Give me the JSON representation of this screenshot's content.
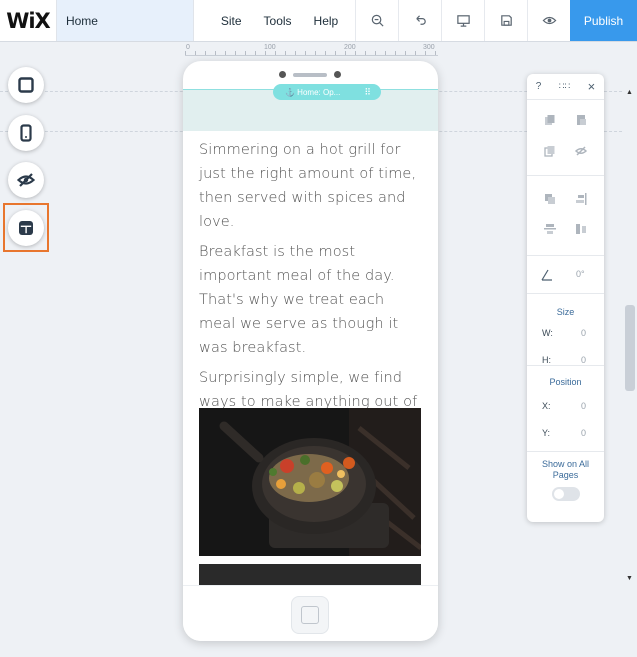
{
  "topbar": {
    "logo": "WiX",
    "page": "Home",
    "menu": [
      "Site",
      "Tools",
      "Help"
    ],
    "tools": [
      "zoom-out-icon",
      "undo-icon",
      "desktop-icon",
      "save-icon",
      "preview-icon"
    ],
    "publish_label": "Publish"
  },
  "ruler": {
    "labels": [
      "0",
      "100",
      "200",
      "300"
    ]
  },
  "leftbar": {
    "buttons": [
      "add-elements-icon",
      "mobile-tools-icon",
      "hidden-elements-icon",
      "layout-optimizer-icon"
    ]
  },
  "phone": {
    "anchor_label": "⚓ Home: Op...",
    "paragraphs": [
      "Simmering on a hot grill for just the right amount of time, then served with spices and love.",
      "Breakfast is the most important meal of the day. That's why we treat each meal we serve as though it was breakfast.",
      "Surprisingly simple, we find ways to make anything out of everything. Come in and try!"
    ]
  },
  "panel": {
    "help": "?",
    "close": "×",
    "rotation": "0°",
    "size_title": "Size",
    "w_label": "W:",
    "w_value": "0",
    "h_label": "H:",
    "h_value": "0",
    "position_title": "Position",
    "x_label": "X:",
    "x_value": "0",
    "y_label": "Y:",
    "y_value": "0",
    "show_all_pages": "Show on All Pages",
    "show_all_pages_on": false
  },
  "colors": {
    "publish": "#3899ec",
    "highlight": "#e8762e",
    "anchor": "#7fe0e0"
  }
}
